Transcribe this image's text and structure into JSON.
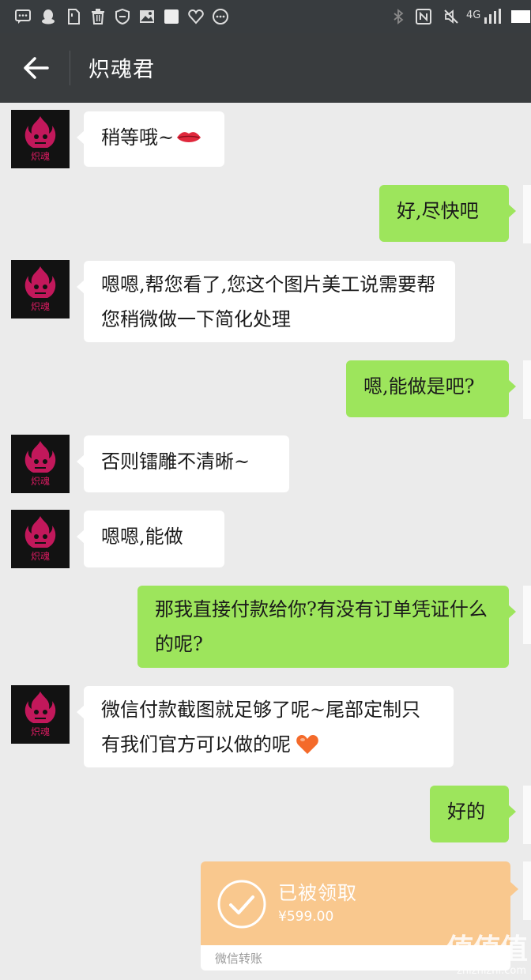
{
  "status_icons": [
    "message-icon",
    "qq-icon",
    "sim-icon",
    "trash-icon",
    "shield-icon",
    "image-icon",
    "square-icon",
    "heart-icon",
    "more-icon",
    "bluetooth-icon",
    "nfc-icon",
    "mute-icon",
    "signal-icon"
  ],
  "status_bar": {
    "network_label": "4G"
  },
  "header": {
    "title": "炽魂君"
  },
  "avatar": {
    "caption": "炽魂"
  },
  "messages": [
    {
      "side": "in",
      "text": "稍等哦~"
    },
    {
      "side": "out",
      "text": "好,尽快吧"
    },
    {
      "side": "in",
      "text": "嗯嗯,帮您看了,您这个图片美工说需要帮您稍微做一下简化处理"
    },
    {
      "side": "out",
      "text": "嗯,能做是吧?"
    },
    {
      "side": "in",
      "text": "否则镭雕不清晰~"
    },
    {
      "side": "in",
      "text": "嗯嗯,能做"
    },
    {
      "side": "out",
      "text": "那我直接付款给你?有没有订单凭证什么的呢?"
    },
    {
      "side": "in",
      "text": "微信付款截图就足够了呢~尾部定制只有我们官方可以做的呢"
    },
    {
      "side": "out",
      "text": "好的"
    }
  ],
  "transfer": {
    "status": "已被领取",
    "amount": "¥599.00",
    "label": "微信转账"
  },
  "watermark": {
    "logo": "值值值",
    "url": "zhizhizhi.com"
  },
  "colors": {
    "out_bubble": "#9de55c",
    "in_bubble": "#ffffff",
    "transfer": "#f9c88e",
    "background": "#ebebeb",
    "header": "#393c3e",
    "emoji_lips": "#e0283c",
    "emoji_heart": "#f46a2a"
  }
}
